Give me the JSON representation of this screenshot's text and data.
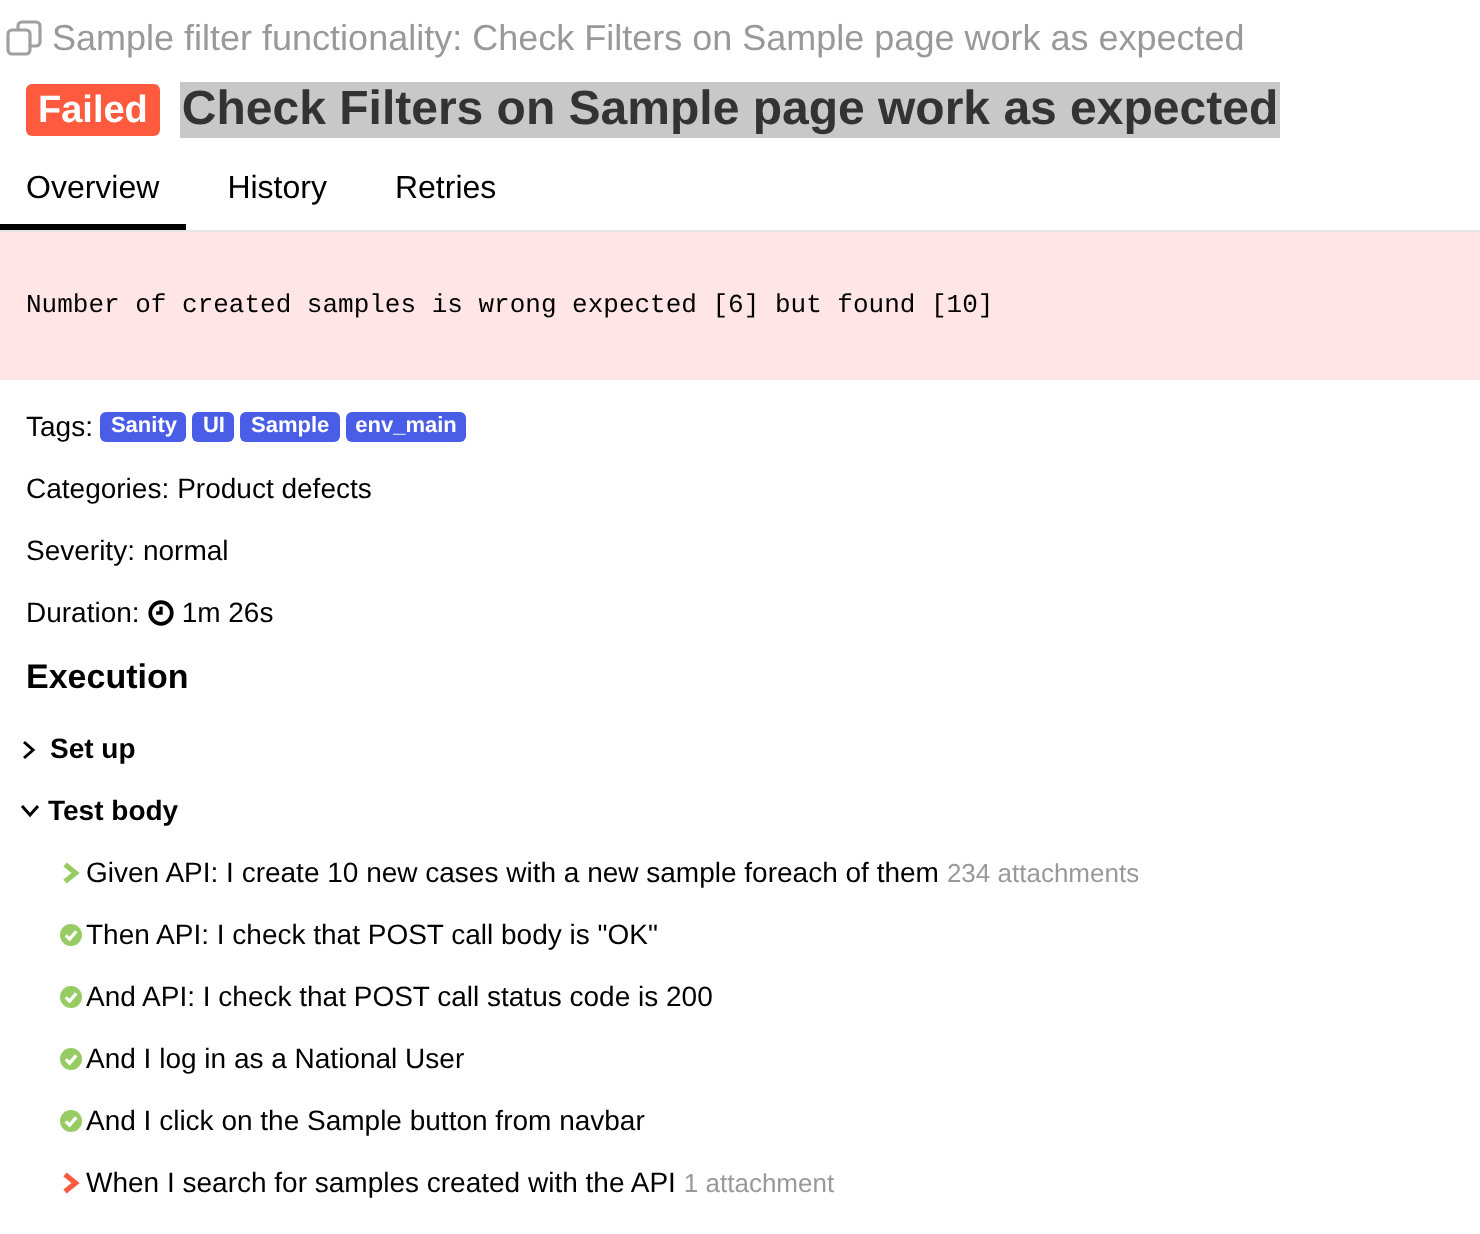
{
  "suite": {
    "title": "Sample filter functionality: Check Filters on Sample page work as expected"
  },
  "test": {
    "color": "#fd5a3e",
    "status_label": "Failed",
    "title": "Check Filters on Sample page work as expected",
    "title_selected": true
  },
  "tabs": [
    {
      "label": "Overview",
      "selected": true
    },
    {
      "label": "History",
      "selected": false
    },
    {
      "label": "Retries",
      "selected": false
    }
  ],
  "error": {
    "message": "Number of created samples is wrong expected [6] but found [10]"
  },
  "tags": {
    "label": "Tags:",
    "items": [
      {
        "label": "Sanity"
      },
      {
        "label": "UI"
      },
      {
        "label": "Sample"
      },
      {
        "label": "env_main"
      }
    ]
  },
  "fields": [
    {
      "kind": "text",
      "label": "Categories:",
      "value": "Product defects"
    },
    {
      "kind": "text",
      "label": "Severity:",
      "value": "normal"
    },
    {
      "kind": "duration",
      "label": "Duration:",
      "value": "1m 26s"
    }
  ],
  "execution": {
    "heading": "Execution",
    "sections": [
      {
        "label": "Set up",
        "expanded": false
      },
      {
        "label": "Test body",
        "expanded": true,
        "steps": [
          {
            "text": "Given API: I create 10 new cases with a new sample foreach of them",
            "color": "#97cc64",
            "expandable": true,
            "attachments": "234 attachments"
          },
          {
            "text": "Then API: I check that POST call body is \"OK\"",
            "color": "#97cc64",
            "expandable": false
          },
          {
            "text": "And API: I check that POST call status code is 200",
            "color": "#97cc64",
            "expandable": false
          },
          {
            "text": "And I log in as a National User",
            "color": "#97cc64",
            "expandable": false
          },
          {
            "text": "And I click on the Sample button from navbar",
            "color": "#97cc64",
            "expandable": false
          },
          {
            "text": "When I search for samples created with the API",
            "color": "#fd5a3e",
            "expandable": true,
            "attachments": "1 attachment"
          }
        ]
      }
    ]
  }
}
